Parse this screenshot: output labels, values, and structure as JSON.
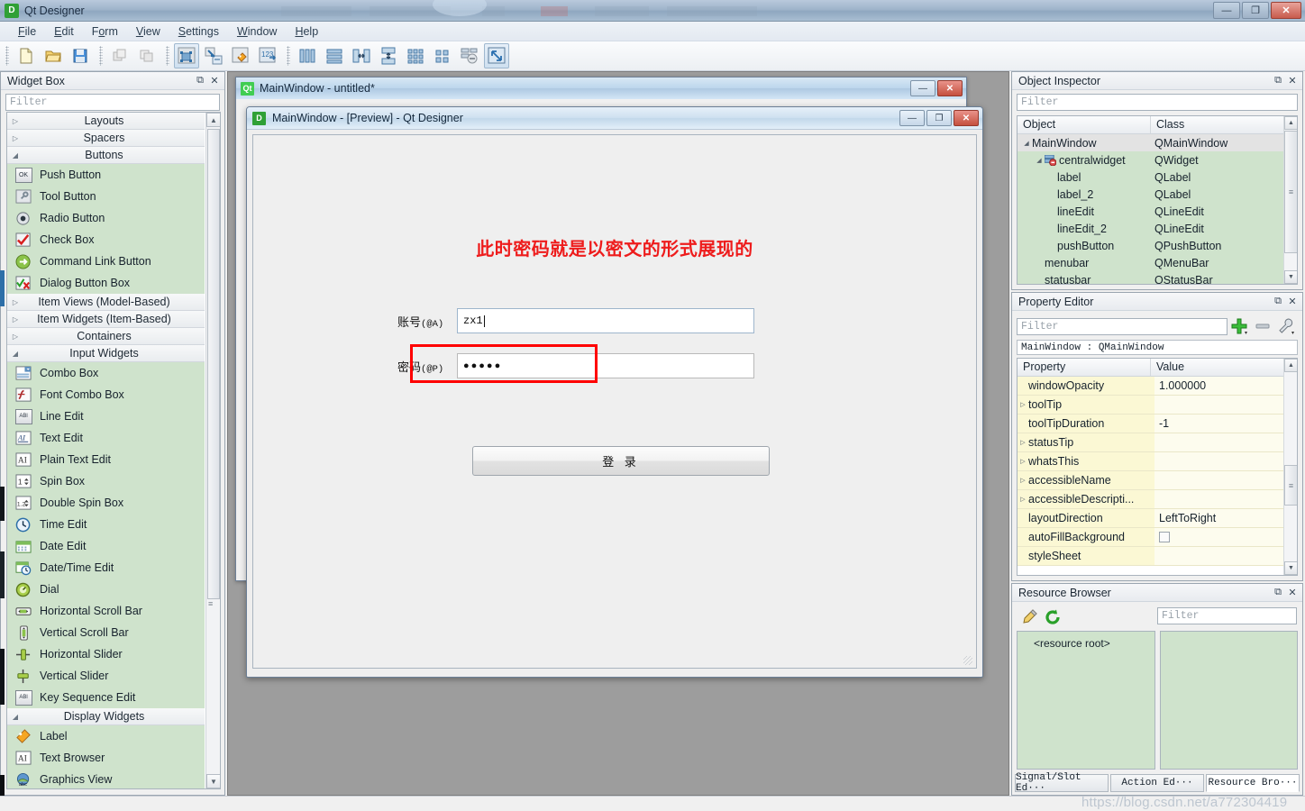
{
  "window": {
    "title": "Qt Designer",
    "icon": "D",
    "minimize_label": "—",
    "maximize_label": "❐",
    "close_label": "✕"
  },
  "menubar": {
    "items": [
      {
        "pre": "",
        "key": "F",
        "post": "ile"
      },
      {
        "pre": "",
        "key": "E",
        "post": "dit"
      },
      {
        "pre": "F",
        "key": "o",
        "post": "rm"
      },
      {
        "pre": "",
        "key": "V",
        "post": "iew"
      },
      {
        "pre": "",
        "key": "S",
        "post": "ettings"
      },
      {
        "pre": "",
        "key": "W",
        "post": "indow"
      },
      {
        "pre": "",
        "key": "H",
        "post": "elp"
      }
    ]
  },
  "toolbar": {
    "buttons": [
      {
        "name": "new-form-icon",
        "title": "New"
      },
      {
        "name": "open-form-icon",
        "title": "Open"
      },
      {
        "name": "save-form-icon",
        "title": "Save"
      },
      {
        "name": "undo-icon",
        "title": "Undo"
      },
      {
        "name": "redo-icon",
        "title": "Redo"
      },
      {
        "name": "edit-widgets-icon",
        "title": "Edit Widgets"
      },
      {
        "name": "edit-signals-slots-icon",
        "title": "Edit Signals/Slots"
      },
      {
        "name": "edit-buddies-icon",
        "title": "Edit Buddies"
      },
      {
        "name": "edit-tab-order-icon",
        "title": "Edit Tab Order"
      },
      {
        "name": "layout-horizontally-icon",
        "title": "Lay Out Horizontally"
      },
      {
        "name": "layout-vertically-icon",
        "title": "Lay Out Vertically"
      },
      {
        "name": "layout-splitter-h-icon",
        "title": "Lay Out Horizontally in Splitter"
      },
      {
        "name": "layout-splitter-v-icon",
        "title": "Lay Out Vertically in Splitter"
      },
      {
        "name": "layout-grid-icon",
        "title": "Lay Out in a Grid"
      },
      {
        "name": "layout-form-icon",
        "title": "Lay Out in a Form Layout"
      },
      {
        "name": "break-layout-icon",
        "title": "Break Layout"
      },
      {
        "name": "adjust-size-icon",
        "title": "Adjust Size"
      }
    ]
  },
  "widget_box": {
    "title": "Widget Box",
    "filter_placeholder": "Filter",
    "groups": [
      {
        "label": "Layouts",
        "expanded": false,
        "items": []
      },
      {
        "label": "Spacers",
        "expanded": false,
        "items": []
      },
      {
        "label": "Buttons",
        "expanded": true,
        "items": [
          {
            "label": "Push Button",
            "icon": "push-button-icon"
          },
          {
            "label": "Tool Button",
            "icon": "tool-button-icon"
          },
          {
            "label": "Radio Button",
            "icon": "radio-button-icon"
          },
          {
            "label": "Check Box",
            "icon": "check-box-icon"
          },
          {
            "label": "Command Link Button",
            "icon": "command-link-button-icon"
          },
          {
            "label": "Dialog Button Box",
            "icon": "dialog-button-box-icon"
          }
        ]
      },
      {
        "label": "Item Views (Model-Based)",
        "expanded": false,
        "items": []
      },
      {
        "label": "Item Widgets (Item-Based)",
        "expanded": false,
        "items": []
      },
      {
        "label": "Containers",
        "expanded": false,
        "items": []
      },
      {
        "label": "Input Widgets",
        "expanded": true,
        "items": [
          {
            "label": "Combo Box",
            "icon": "combo-box-icon"
          },
          {
            "label": "Font Combo Box",
            "icon": "font-combo-box-icon"
          },
          {
            "label": "Line Edit",
            "icon": "line-edit-icon"
          },
          {
            "label": "Text Edit",
            "icon": "text-edit-icon"
          },
          {
            "label": "Plain Text Edit",
            "icon": "plain-text-edit-icon"
          },
          {
            "label": "Spin Box",
            "icon": "spin-box-icon"
          },
          {
            "label": "Double Spin Box",
            "icon": "double-spin-box-icon"
          },
          {
            "label": "Time Edit",
            "icon": "time-edit-icon"
          },
          {
            "label": "Date Edit",
            "icon": "date-edit-icon"
          },
          {
            "label": "Date/Time Edit",
            "icon": "date-time-edit-icon"
          },
          {
            "label": "Dial",
            "icon": "dial-icon"
          },
          {
            "label": "Horizontal Scroll Bar",
            "icon": "horizontal-scroll-bar-icon"
          },
          {
            "label": "Vertical Scroll Bar",
            "icon": "vertical-scroll-bar-icon"
          },
          {
            "label": "Horizontal Slider",
            "icon": "horizontal-slider-icon"
          },
          {
            "label": "Vertical Slider",
            "icon": "vertical-slider-icon"
          },
          {
            "label": "Key Sequence Edit",
            "icon": "key-sequence-edit-icon"
          }
        ]
      },
      {
        "label": "Display Widgets",
        "expanded": true,
        "items": [
          {
            "label": "Label",
            "icon": "label-icon"
          },
          {
            "label": "Text Browser",
            "icon": "text-browser-icon"
          },
          {
            "label": "Graphics View",
            "icon": "graphics-view-icon"
          }
        ]
      }
    ]
  },
  "form_window": {
    "title": "MainWindow - untitled*",
    "icon": "Qt"
  },
  "preview": {
    "title": "MainWindow - [Preview] - Qt Designer",
    "icon": "D",
    "heading": "此时密码就是以密文的形式展现的",
    "heading_color": "#ee1c1c",
    "fields": [
      {
        "label_cn": "账号",
        "label_key": "(@A)",
        "value": "zx1",
        "type": "text"
      },
      {
        "label_cn": "密码",
        "label_key": "(@P)",
        "value": "●●●●●",
        "type": "password"
      }
    ],
    "highlight_color": "#ff0000",
    "login_button": "登 录"
  },
  "object_inspector": {
    "title": "Object Inspector",
    "filter_placeholder": "Filter",
    "columns": [
      "Object",
      "Class"
    ],
    "rows": [
      {
        "object": "MainWindow",
        "class": "QMainWindow",
        "indent": 0,
        "expander": "▲",
        "selected": true
      },
      {
        "object": "centralwidget",
        "class": "QWidget",
        "indent": 1,
        "expander": "▲",
        "icon": "widget-icon"
      },
      {
        "object": "label",
        "class": "QLabel",
        "indent": 2,
        "expander": ""
      },
      {
        "object": "label_2",
        "class": "QLabel",
        "indent": 2,
        "expander": ""
      },
      {
        "object": "lineEdit",
        "class": "QLineEdit",
        "indent": 2,
        "expander": ""
      },
      {
        "object": "lineEdit_2",
        "class": "QLineEdit",
        "indent": 2,
        "expander": ""
      },
      {
        "object": "pushButton",
        "class": "QPushButton",
        "indent": 2,
        "expander": ""
      },
      {
        "object": "menubar",
        "class": "QMenuBar",
        "indent": 1,
        "expander": ""
      },
      {
        "object": "statusbar",
        "class": "QStatusBar",
        "indent": 1,
        "expander": ""
      }
    ]
  },
  "property_editor": {
    "title": "Property Editor",
    "filter_placeholder": "Filter",
    "object_line": "MainWindow : QMainWindow",
    "columns": [
      "Property",
      "Value"
    ],
    "add_icon": "add-icon",
    "remove_icon": "remove-icon",
    "configure_icon": "wrench-icon",
    "rows": [
      {
        "property": "windowOpacity",
        "value": "1.000000",
        "expandable": false
      },
      {
        "property": "toolTip",
        "value": "",
        "expandable": true
      },
      {
        "property": "toolTipDuration",
        "value": "-1",
        "expandable": false
      },
      {
        "property": "statusTip",
        "value": "",
        "expandable": true
      },
      {
        "property": "whatsThis",
        "value": "",
        "expandable": true
      },
      {
        "property": "accessibleName",
        "value": "",
        "expandable": true
      },
      {
        "property": "accessibleDescripti...",
        "value": "",
        "expandable": true
      },
      {
        "property": "layoutDirection",
        "value": "LeftToRight",
        "expandable": false
      },
      {
        "property": "autoFillBackground",
        "value": "",
        "expandable": false,
        "checkbox": true
      },
      {
        "property": "styleSheet",
        "value": "",
        "expandable": false
      }
    ]
  },
  "resource_browser": {
    "title": "Resource Browser",
    "filter_placeholder": "Filter",
    "edit_icon": "pencil-icon",
    "reload_icon": "reload-icon",
    "root_label": "<resource root>",
    "tabs": [
      {
        "label": "Signal/Slot Ed···",
        "selected": false
      },
      {
        "label": "Action Ed···",
        "selected": false
      },
      {
        "label": "Resource Bro···",
        "selected": true
      }
    ]
  },
  "watermark": "https://blog.csdn.net/a772304419"
}
